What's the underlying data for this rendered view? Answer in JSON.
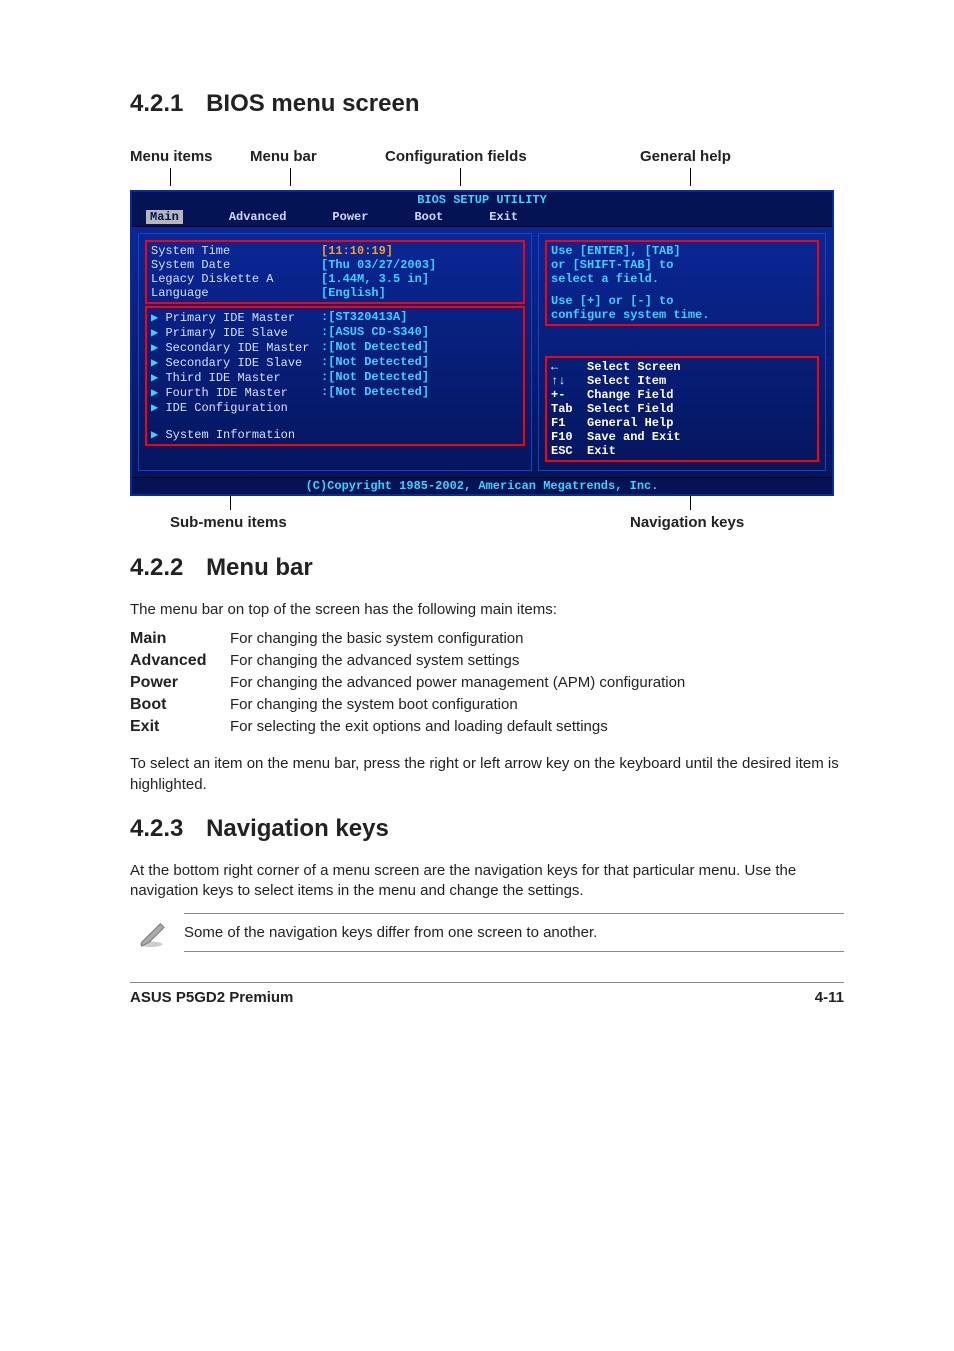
{
  "s421": {
    "num": "4.2.1",
    "title": "BIOS menu screen"
  },
  "s422": {
    "num": "4.2.2",
    "title": "Menu bar"
  },
  "s423": {
    "num": "4.2.3",
    "title": "Navigation keys"
  },
  "labels": {
    "menu_items": "Menu items",
    "menu_bar": "Menu bar",
    "config_fields": "Configuration fields",
    "general_help": "General help",
    "submenu": "Sub-menu items",
    "navkeys": "Navigation keys"
  },
  "bios": {
    "title": "BIOS SETUP UTILITY",
    "tabs": {
      "main": "Main",
      "advanced": "Advanced",
      "power": "Power",
      "boot": "Boot",
      "exit": "Exit"
    },
    "items": {
      "sys_time": {
        "k": "System Time",
        "v": "[11:10:19]"
      },
      "sys_date": {
        "k": "System Date",
        "v": "[Thu 03/27/2003]"
      },
      "diskette": {
        "k": "Legacy Diskette A",
        "v": "[1.44M, 3.5 in]"
      },
      "language": {
        "k": "Language",
        "v": "[English]"
      },
      "pide_m": {
        "k": "Primary IDE Master",
        "v": ":[ST320413A]"
      },
      "pide_s": {
        "k": "Primary IDE Slave",
        "v": ":[ASUS CD-S340]"
      },
      "side_m": {
        "k": "Secondary IDE Master",
        "v": ":[Not Detected]"
      },
      "side_s": {
        "k": "Secondary IDE Slave",
        "v": ":[Not Detected]"
      },
      "tide_m": {
        "k": "Third IDE Master",
        "v": ":[Not Detected]"
      },
      "fide_m": {
        "k": "Fourth IDE Master",
        "v": ":[Not Detected]"
      },
      "ide_cfg": {
        "k": "IDE Configuration",
        "v": ""
      },
      "sys_info": {
        "k": "System Information",
        "v": ""
      }
    },
    "help": {
      "l1": "Use [ENTER], [TAB]",
      "l2": "or [SHIFT-TAB] to",
      "l3": "select a field.",
      "l4": "Use [+] or [-] to",
      "l5": "configure system time."
    },
    "nav": {
      "arrow_lr": {
        "k": "←",
        "d": "Select Screen"
      },
      "arrow_ud": {
        "k": "↑↓",
        "d": "Select Item"
      },
      "plusminus": {
        "k": "+-",
        "d": "Change Field"
      },
      "tab": {
        "k": "Tab",
        "d": "Select Field"
      },
      "f1": {
        "k": "F1",
        "d": "General Help"
      },
      "f10": {
        "k": "F10",
        "d": "Save and Exit"
      },
      "esc": {
        "k": "ESC",
        "d": "Exit"
      }
    },
    "copyright": "(C)Copyright 1985-2002, American Megatrends, Inc."
  },
  "menubar_intro": "The menu bar on top of the screen has the following main items:",
  "defs": {
    "main": {
      "t": "Main",
      "d": "For changing the basic system configuration"
    },
    "advanced": {
      "t": "Advanced",
      "d": "For changing the advanced system settings"
    },
    "power": {
      "t": "Power",
      "d": "For changing the advanced power management (APM) configuration"
    },
    "boot": {
      "t": "Boot",
      "d": "For changing the system boot configuration"
    },
    "exit": {
      "t": "Exit",
      "d": "For selecting the exit options and loading default settings"
    }
  },
  "menubar_tip": "To select an item on the menu bar, press the right or left arrow key on the keyboard until the desired item is highlighted.",
  "navkeys_intro": "At the bottom right corner of a menu screen are the navigation keys for that particular menu. Use the navigation keys to select items in the menu and change the settings.",
  "note": "Some of the navigation keys differ from one screen to another.",
  "footer": {
    "left": "ASUS P5GD2 Premium",
    "right": "4-11"
  }
}
